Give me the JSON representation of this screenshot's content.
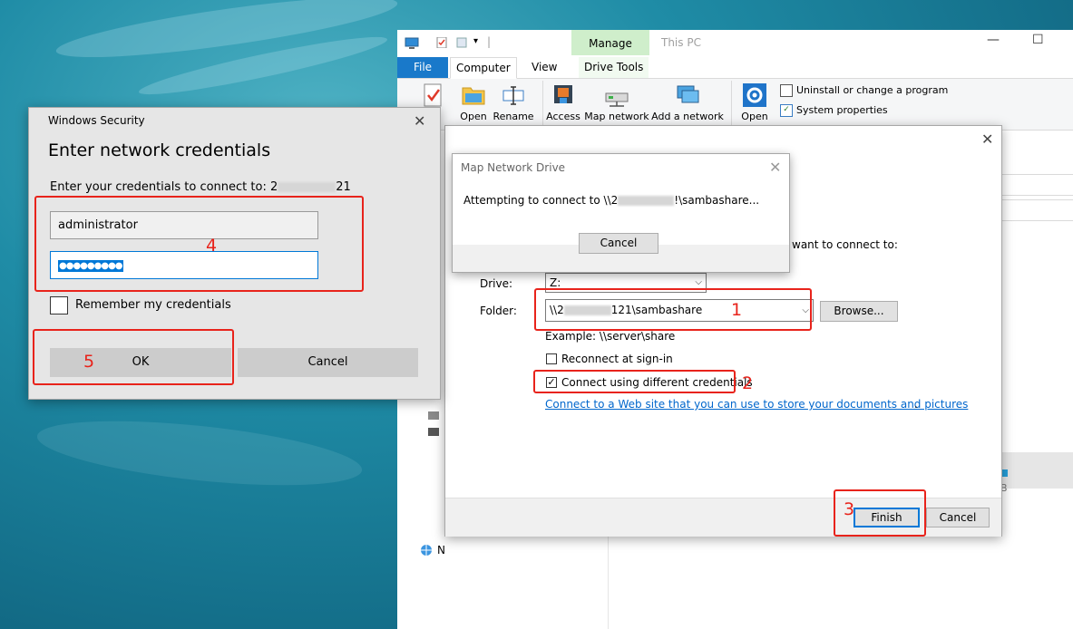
{
  "explorer": {
    "title": "This PC",
    "manage_tab": "Manage",
    "tabs": {
      "file": "File",
      "computer": "Computer",
      "view": "View",
      "drive_tools": "Drive Tools"
    },
    "ribbon": {
      "properties": "ies",
      "open": "Open",
      "rename": "Rename",
      "access": "Access",
      "map_network": "Map network",
      "add_network": "Add a network",
      "open2": "Open",
      "uninstall": "Uninstall or change a program",
      "system_properties": "System properties"
    },
    "nav_partial": "N",
    "content_partial": "B"
  },
  "wizard": {
    "instruction_tail": "want to connect to:",
    "drive_label": "Drive:",
    "drive_value": "Z:",
    "folder_label": "Folder:",
    "folder_prefix": "\\\\2",
    "folder_suffix": "121\\sambashare",
    "browse": "Browse...",
    "example": "Example: \\\\server\\share",
    "reconnect": "Reconnect at sign-in",
    "different_credentials": "Connect using different credentials",
    "web_link": "Connect to a Web site that you can use to store your documents and pictures",
    "finish": "Finish",
    "cancel": "Cancel"
  },
  "popup": {
    "title": "Map Network Drive",
    "message_prefix": "Attempting to connect to \\\\2",
    "message_suffix": "!\\sambashare...",
    "cancel": "Cancel"
  },
  "security": {
    "window_title": "Windows Security",
    "heading": "Enter network credentials",
    "prompt_prefix": "Enter your credentials to connect to: 2",
    "prompt_suffix": "21",
    "username": "administrator",
    "password_mask": "●●●●●●●●●",
    "remember": "Remember my credentials",
    "ok": "OK",
    "cancel": "Cancel"
  },
  "annotations": [
    "1",
    "2",
    "3",
    "4",
    "5"
  ],
  "colors": {
    "annotation_red": "#e8231b",
    "file_tab": "#1979ca",
    "manage_tab": "#cfeecb",
    "focus_blue": "#0078d7"
  }
}
